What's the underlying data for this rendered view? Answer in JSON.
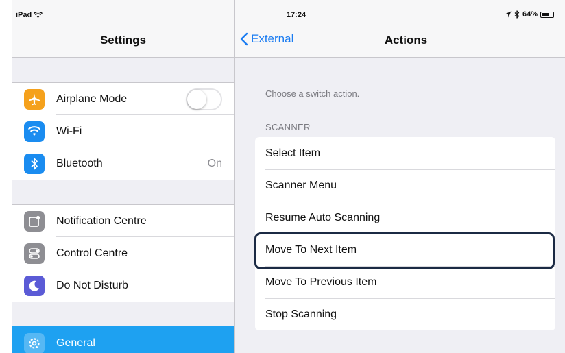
{
  "status_bar": {
    "device": "iPad",
    "time": "17:24",
    "battery": "64%",
    "battery_level": 0.64
  },
  "left_pane": {
    "title": "Settings",
    "groups": [
      {
        "items": [
          {
            "label": "Airplane Mode",
            "icon": "airplane-icon",
            "icon_color": "#f5a11c",
            "toggle_on": false
          },
          {
            "label": "Wi-Fi",
            "icon": "wifi-icon",
            "icon_color": "#1a8cf0"
          },
          {
            "label": "Bluetooth",
            "icon": "bluetooth-icon",
            "icon_color": "#1a8cf0",
            "value": "On"
          }
        ]
      },
      {
        "items": [
          {
            "label": "Notification Centre",
            "icon": "notification-centre-icon",
            "icon_color": "#8e8e93"
          },
          {
            "label": "Control Centre",
            "icon": "control-centre-icon",
            "icon_color": "#8e8e93"
          },
          {
            "label": "Do Not Disturb",
            "icon": "moon-icon",
            "icon_color": "#5b5bd6"
          }
        ]
      }
    ],
    "selected_item": {
      "label": "General",
      "icon": "gear-icon"
    },
    "selection_color": "#1ea1f1"
  },
  "right_pane": {
    "back_label": "External",
    "title": "Actions",
    "hint": "Choose a switch action.",
    "section_header": "SCANNER",
    "actions": [
      "Select Item",
      "Scanner Menu",
      "Resume Auto Scanning",
      "Move To Next Item",
      "Move To Previous Item",
      "Stop Scanning"
    ],
    "focused_action": "Move To Next Item"
  },
  "colors": {
    "accent": "#1a7cf2",
    "focus_ring": "#1b2a44"
  }
}
